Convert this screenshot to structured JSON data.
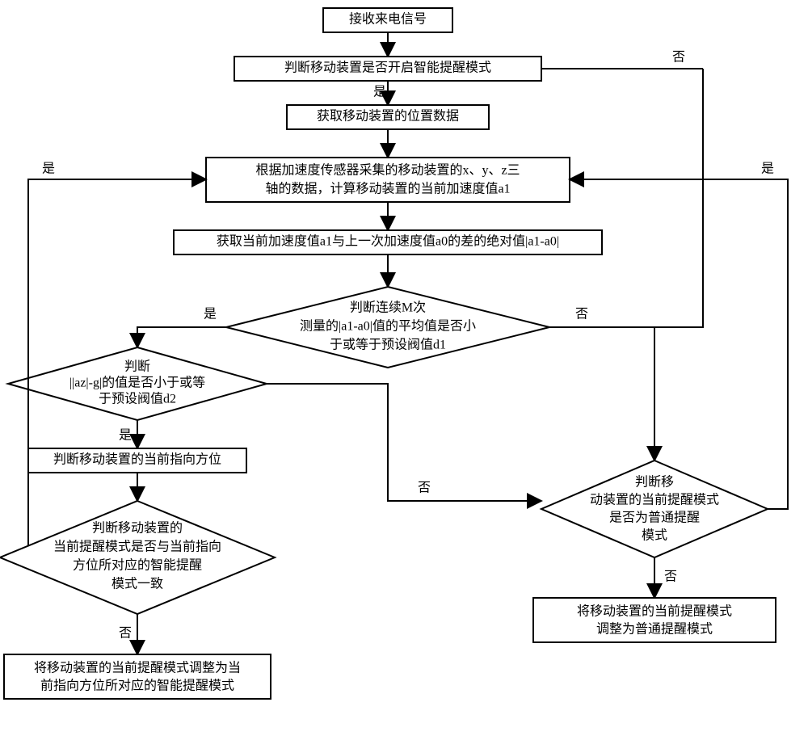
{
  "nodes": {
    "n1": "接收来电信号",
    "n2": "判断移动装置是否开启智能提醒模式",
    "n3": "获取移动装置的位置数据",
    "n4_l1": "根据加速度传感器采集的移动装置的x、y、z三",
    "n4_l2": "轴的数据，计算移动装置的当前加速度值a1",
    "n5": "获取当前加速度值a1与上一次加速度值a0的差的绝对值|a1-a0|",
    "n6_l1": "判断连续M次",
    "n6_l2": "测量的|a1-a0|值的平均值是否小",
    "n6_l3": "于或等于预设阀值d1",
    "n7_l1": "判断",
    "n7_l2": "||az|-g|的值是否小于或等",
    "n7_l3": "于预设阀值d2",
    "n8": "判断移动装置的当前指向方位",
    "n9_l1": "判断移动装置的",
    "n9_l2": "当前提醒模式是否与当前指向",
    "n9_l3": "方位所对应的智能提醒",
    "n9_l4": "模式一致",
    "n10_l1": "将移动装置的当前提醒模式调整为当",
    "n10_l2": "前指向方位所对应的智能提醒模式",
    "n11_l1": "判断移",
    "n11_l2": "动装置的当前提醒模式",
    "n11_l3": "是否为普通提醒",
    "n11_l4": "模式",
    "n12_l1": "将移动装置的当前提醒模式",
    "n12_l2": "调整为普通提醒模式"
  },
  "labels": {
    "yes": "是",
    "no": "否"
  }
}
